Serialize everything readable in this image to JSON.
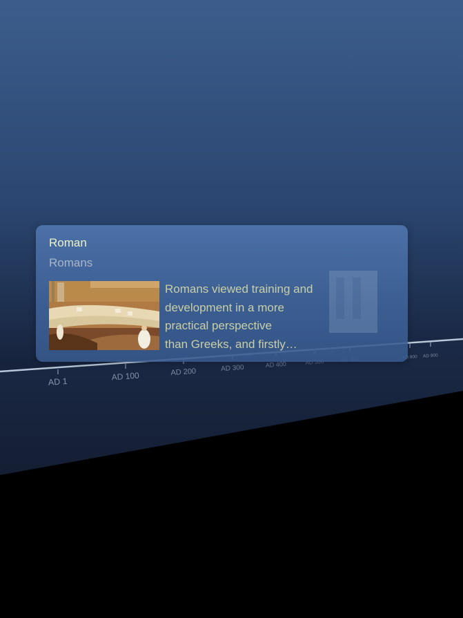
{
  "timeline": {
    "ticks": [
      "AD 1",
      "AD 100",
      "AD 200",
      "AD 300",
      "AD 400",
      "AD 500",
      "AD 600",
      "AD 800",
      "AD 900"
    ]
  },
  "card": {
    "title": "Roman",
    "subtitle": "Romans",
    "description_lines": [
      "Romans viewed training and",
      "development in a more",
      "practical perspective",
      "than Greeks, and firstly…"
    ],
    "image_icon": "roman-senate-painting"
  },
  "colors": {
    "background_top": "#3c5d8c",
    "background_bottom": "#15213a",
    "floor": "#000000",
    "title": "#eef3c8",
    "subtitle": "#a9b6c8",
    "description": "#c9cfa6"
  }
}
